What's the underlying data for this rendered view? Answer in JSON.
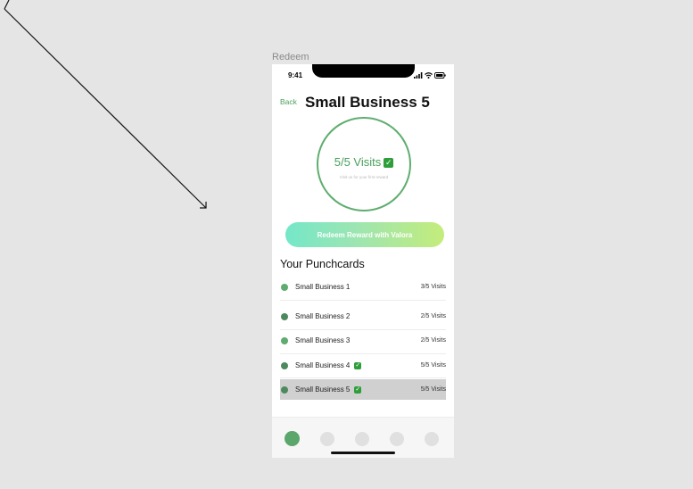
{
  "frame_label": "Redeem",
  "status_bar": {
    "time": "9:41",
    "icons": [
      "signal-icon",
      "wifi-icon",
      "battery-icon"
    ]
  },
  "header": {
    "back_label": "Back",
    "title": "Small Business 5"
  },
  "progress": {
    "visits_text": "5/5 Visits",
    "current": 5,
    "total": 5,
    "completed": true,
    "subtext": "Visit us for your first reward"
  },
  "redeem_button": {
    "label": "Redeem Reward with Valora"
  },
  "punchcards": {
    "title": "Your Punchcards",
    "items": [
      {
        "name": "Small Business 1",
        "visits": "3/5 Visits",
        "completed": false,
        "dot_color": "#5fab70"
      },
      {
        "name": "Small Business 2",
        "visits": "2/5 Visits",
        "completed": false,
        "dot_color": "#4c8a5e"
      },
      {
        "name": "Small Business 3",
        "visits": "2/5 Visits",
        "completed": false,
        "dot_color": "#5fab70"
      },
      {
        "name": "Small Business 4",
        "visits": "5/5 Visits",
        "completed": true,
        "dot_color": "#4c8a5e"
      },
      {
        "name": "Small Business 5",
        "visits": "5/5 Visits",
        "completed": true,
        "dot_color": "#4c8a5e",
        "selected": true
      }
    ]
  },
  "tabbar": {
    "tab_count": 5,
    "active_index": 0
  },
  "colors": {
    "accent": "#4aa05c",
    "circle_border": "#5fad6f",
    "button_gradient": [
      "#74e7c9",
      "#9de5b1",
      "#c4ec7b"
    ],
    "check": "#2e9e3a"
  }
}
